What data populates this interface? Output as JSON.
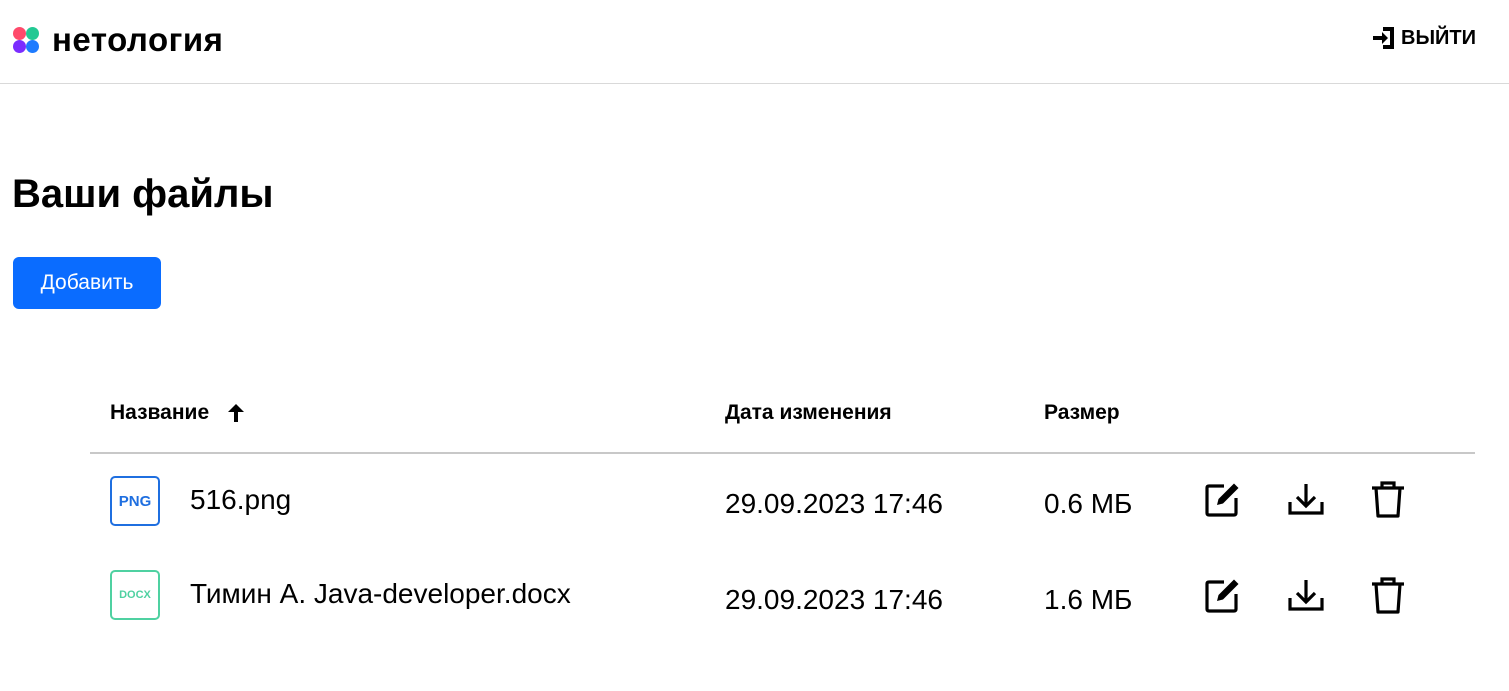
{
  "header": {
    "logo_text": "нетология",
    "logo_colors": [
      "#ff4a6b",
      "#22c993",
      "#7b2dff",
      "#1e7bff"
    ],
    "logout_label": "ВЫЙТИ"
  },
  "main": {
    "title": "Ваши файлы",
    "add_button_label": "Добавить",
    "accent_color": "#0a6cff"
  },
  "table": {
    "columns": {
      "name": "Название",
      "date": "Дата изменения",
      "size": "Размер"
    },
    "sort": {
      "column": "name",
      "direction": "ascending",
      "icon": "arrow-up-icon"
    },
    "rows": [
      {
        "type_badge": "PNG",
        "badge_color": "#1f6fe0",
        "name": "516.png",
        "date": "29.09.2023 17:46",
        "size": "0.6 МБ"
      },
      {
        "type_badge": "DOCX",
        "badge_color": "#4fd1a1",
        "name": "Тимин А. Java-developer.docx",
        "date": "29.09.2023 17:46",
        "size": "1.6 МБ"
      }
    ],
    "row_actions": [
      "edit-icon",
      "download-icon",
      "trash-icon"
    ]
  }
}
